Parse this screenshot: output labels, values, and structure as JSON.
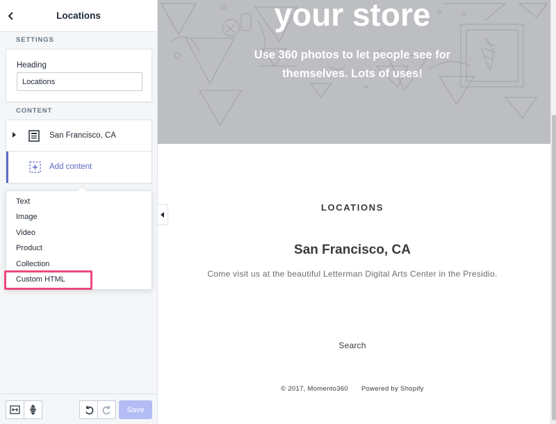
{
  "sidebar": {
    "title": "Locations",
    "settings_label": "SETTINGS",
    "heading_label": "Heading",
    "heading_value": "Locations",
    "content_label": "CONTENT",
    "block_label": "San Francisco, CA",
    "add_content_label": "Add content",
    "menu_items": [
      "Text",
      "Image",
      "Video",
      "Product",
      "Collection",
      "Custom HTML"
    ],
    "save_label": "Save"
  },
  "preview": {
    "hero_title": "your store",
    "hero_subtitle": "Use 360 photos to let people see for themselves. Lots of uses!",
    "locations_heading": "LOCATIONS",
    "location_name": "San Francisco, CA",
    "location_description": "Come visit us at the beautiful Letterman Digital Arts Center in the Presidio.",
    "search_label": "Search",
    "copyright": "© 2017, Momento360",
    "powered_by": "Powered by Shopify"
  },
  "colors": {
    "accent": "#5c6ac4",
    "highlight": "#ec4a7c",
    "save_disabled": "#b3bcf5",
    "hero_bg": "#bdbec1"
  }
}
